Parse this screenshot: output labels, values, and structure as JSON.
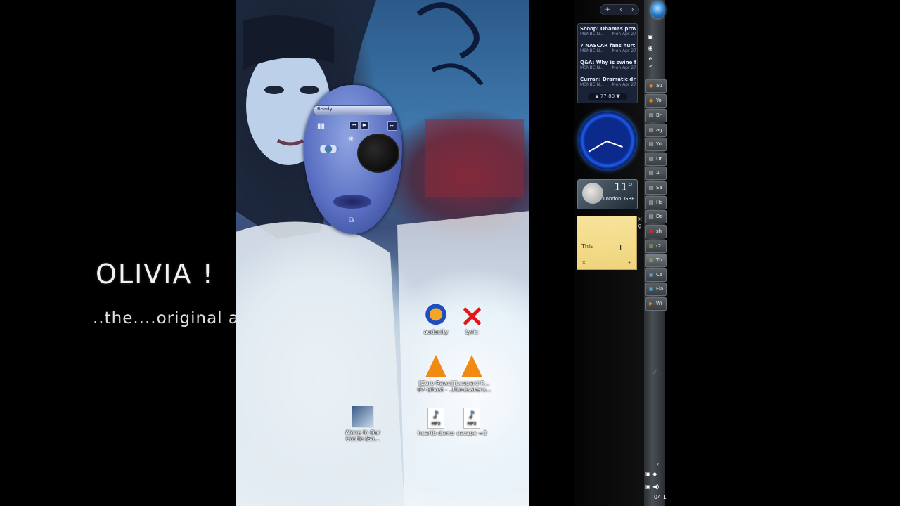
{
  "overlay": {
    "title": "OLIVIA !",
    "subtitle": "..the....original artist ..."
  },
  "player_skin": {
    "status": "Ready"
  },
  "desktop_icons": [
    {
      "label": "audacity",
      "icon": "audacity-icon"
    },
    {
      "label": "Lyric",
      "icon": "lyric-icon"
    },
    {
      "label": "[Zero Raws] 07-Ghost - ...",
      "icon": "vlc-icon"
    },
    {
      "label": "[Leopard R... Hanasakeru...",
      "icon": "vlc-icon"
    },
    {
      "label": "Alone In Our Castle (Sa...",
      "icon": "media-thumbnail-icon"
    },
    {
      "label": "heartb demo",
      "icon": "mp3-file-icon"
    },
    {
      "label": "escape =3",
      "icon": "mp3-file-icon"
    }
  ],
  "sidebar": {
    "add_label": "+",
    "nav_left": "‹",
    "nav_right": "›",
    "news": [
      {
        "headline": "Scoop: Obamas prov...",
        "source": "MSNBC N...",
        "date": "Mon Apr 27"
      },
      {
        "headline": "7 NASCAR fans hurt ...",
        "source": "MSNBC N...",
        "date": "Mon Apr 27"
      },
      {
        "headline": "Q&A: Why is swine f...",
        "source": "MSNBC N...",
        "date": "Mon Apr 27"
      },
      {
        "headline": "Curran: Dramatic dra...",
        "source": "MSNBC N...",
        "date": "Mon Apr 27"
      }
    ],
    "news_pager": "77-80",
    "weather": {
      "temp": "11°",
      "location": "London, GBR"
    },
    "note": {
      "text": "This"
    }
  },
  "taskbar": {
    "items": [
      {
        "label": "au",
        "icon": "firefox-icon"
      },
      {
        "label": "Yo",
        "icon": "firefox-icon"
      },
      {
        "label": "Br",
        "icon": "folder-icon"
      },
      {
        "label": "ag",
        "icon": "folder-icon"
      },
      {
        "label": "Yu",
        "icon": "folder-icon"
      },
      {
        "label": "Dr",
        "icon": "folder-icon"
      },
      {
        "label": "Al",
        "icon": "folder-icon"
      },
      {
        "label": "Sa",
        "icon": "folder-icon"
      },
      {
        "label": "Ho",
        "icon": "folder-icon"
      },
      {
        "label": "Do",
        "icon": "folder-icon"
      },
      {
        "label": "sh",
        "icon": "document-icon"
      },
      {
        "label": "r2",
        "icon": "archive-icon"
      },
      {
        "label": "Th",
        "icon": "archive-icon"
      },
      {
        "label": "Ca",
        "icon": "app-icon"
      },
      {
        "label": "Fla",
        "icon": "app-icon"
      },
      {
        "label": "Wi",
        "icon": "media-player-icon"
      }
    ],
    "clock": "04:1"
  }
}
